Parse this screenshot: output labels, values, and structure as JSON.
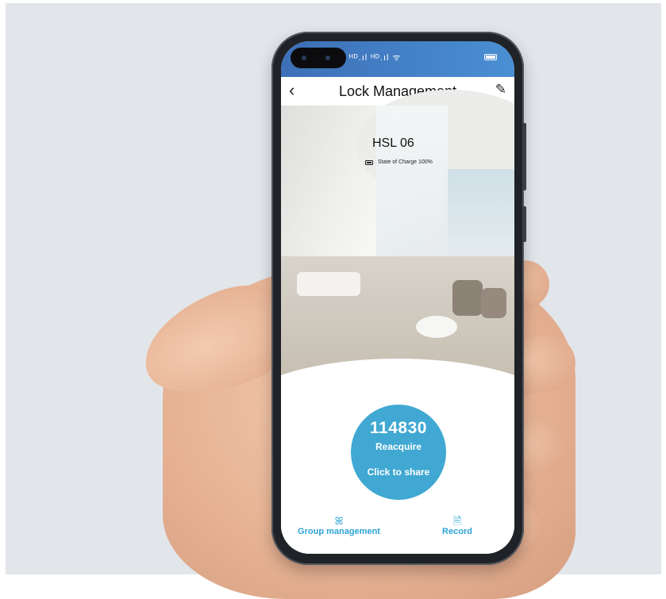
{
  "status_bar": {
    "signal_text": "ᴴᴰ.ıl ᴴᴰ.ıl ᯤ"
  },
  "header": {
    "back_icon": "‹",
    "title": "Lock Management",
    "edit_icon": "✎"
  },
  "lock": {
    "name": "HSL 06",
    "charge_text": "State of Charge 100%"
  },
  "share_button": {
    "code": "114830",
    "reacquire_label": "Reacquire",
    "share_label": "Click to share"
  },
  "tabs": [
    {
      "label": "Group management",
      "icon": "people-icon"
    },
    {
      "label": "Record",
      "icon": "document-icon"
    }
  ],
  "colors": {
    "accent": "#40a8d2",
    "status_bar": "#4a8fd3",
    "tab_text": "#2ea3d6"
  }
}
